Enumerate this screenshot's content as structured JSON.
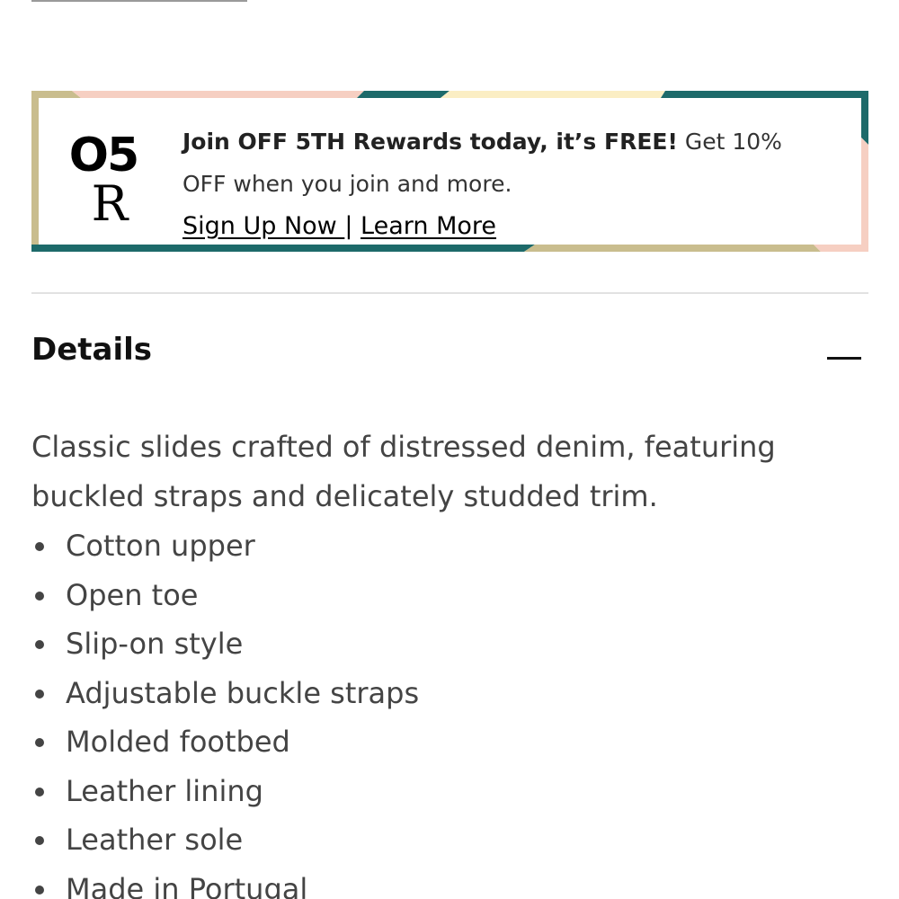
{
  "banner": {
    "logo_top": "O5",
    "logo_bottom": "R",
    "headline": "Join OFF 5TH Rewards today, it’s FREE!",
    "subtext": " Get 10% OFF when you join and more.",
    "signup_link": "Sign Up Now ",
    "separator": "|",
    "learn_link": "Learn More",
    "colors": {
      "teal": "#1d6a6a",
      "peach": "#f6cfc2",
      "cream": "#fbeec4",
      "khaki": "#c9bd8e"
    }
  },
  "details": {
    "title": "Details",
    "collapse_icon": "minus-icon",
    "description": "Classic slides crafted of distressed denim, featuring buckled straps and delicately studded trim.",
    "bullets": [
      "Cotton upper",
      "Open toe",
      "Slip-on style",
      "Adjustable buckle straps",
      "Molded footbed",
      "Leather lining",
      "Leather sole",
      "Made in Portugal"
    ]
  }
}
